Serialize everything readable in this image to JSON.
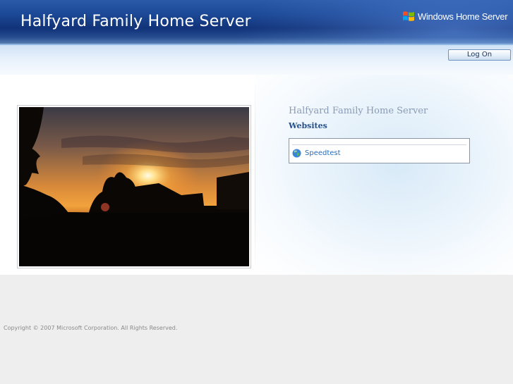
{
  "header": {
    "title": "Halfyard Family Home Server",
    "brand": "Windows Home Server",
    "logo_icon": "windows-flag-icon"
  },
  "toolbar": {
    "logon_label": "Log On"
  },
  "main": {
    "photo_description_icon": "sunset-photo",
    "server_name": "Halfyard Family Home Server",
    "websites_heading": "Websites",
    "websites": [
      {
        "label": "Speedtest",
        "icon": "globe-icon"
      }
    ]
  },
  "footer": {
    "copyright": "Copyright © 2007 Microsoft Corporation. All Rights Reserved."
  },
  "colors": {
    "header_blue": "#1d4a98",
    "link_blue": "#2a6db8",
    "heading_blue": "#27508a"
  }
}
